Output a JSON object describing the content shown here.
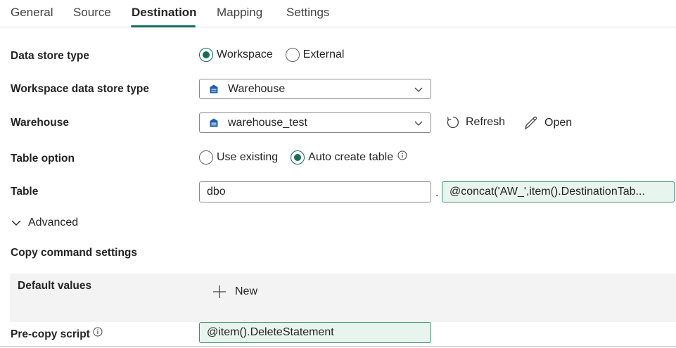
{
  "tabs": [
    {
      "label": "General"
    },
    {
      "label": "Source"
    },
    {
      "label": "Destination"
    },
    {
      "label": "Mapping"
    },
    {
      "label": "Settings"
    }
  ],
  "active_tab": "Destination",
  "data_store_type": {
    "label": "Data store type",
    "options": [
      "Workspace",
      "External"
    ],
    "selected": "Workspace"
  },
  "workspace_store_type": {
    "label": "Workspace data store type",
    "value": "Warehouse",
    "icon": "warehouse-icon"
  },
  "warehouse": {
    "label": "Warehouse",
    "value": "warehouse_test",
    "icon": "warehouse-icon",
    "refresh_label": "Refresh",
    "open_label": "Open"
  },
  "table_option": {
    "label": "Table option",
    "options": [
      "Use existing",
      "Auto create table"
    ],
    "selected": "Auto create table"
  },
  "table": {
    "label": "Table",
    "schema": "dbo",
    "separator": ".",
    "name_expression": "@concat('AW_',item().DestinationTab..."
  },
  "advanced": {
    "label": "Advanced",
    "expanded": true
  },
  "copy_command": {
    "label": "Copy command settings",
    "default_values_label": "Default values",
    "new_label": "New"
  },
  "pre_copy": {
    "label": "Pre-copy script",
    "value": "@item().DeleteStatement"
  },
  "colors": {
    "accent": "#1b6b5a",
    "dynamic_bg": "#e8f5ee",
    "panel_bg": "#f3f3f3"
  }
}
